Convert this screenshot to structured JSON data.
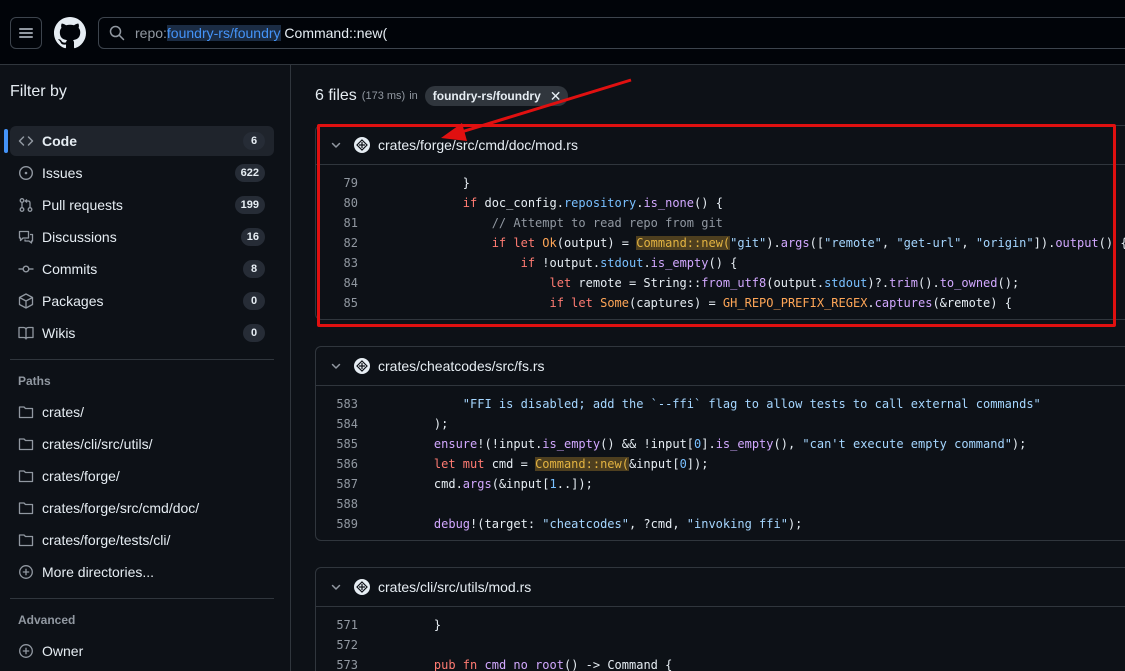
{
  "header": {
    "search_qualifier": "repo:",
    "search_repo": "foundry-rs/foundry",
    "search_text": " Command::new("
  },
  "sidebar": {
    "title": "Filter by",
    "nav": [
      {
        "label": "Code",
        "count": "6",
        "icon": "code-icon",
        "active": true
      },
      {
        "label": "Issues",
        "count": "622",
        "icon": "issue-icon"
      },
      {
        "label": "Pull requests",
        "count": "199",
        "icon": "pull-request-icon"
      },
      {
        "label": "Discussions",
        "count": "16",
        "icon": "discussion-icon"
      },
      {
        "label": "Commits",
        "count": "8",
        "icon": "commit-icon"
      },
      {
        "label": "Packages",
        "count": "0",
        "icon": "package-icon"
      },
      {
        "label": "Wikis",
        "count": "0",
        "icon": "book-icon"
      }
    ],
    "paths_title": "Paths",
    "paths": [
      "crates/",
      "crates/cli/src/utils/",
      "crates/forge/",
      "crates/forge/src/cmd/doc/",
      "crates/forge/tests/cli/"
    ],
    "more_dirs": "More directories...",
    "advanced_title": "Advanced",
    "owner": "Owner"
  },
  "results": {
    "count_text": "6 files",
    "ms": "(173 ms)",
    "in": "in",
    "repo_chip": "foundry-rs/foundry"
  },
  "cards": [
    {
      "path": "crates/forge/src/cmd/doc/mod.rs",
      "lines": [
        "79",
        "80",
        "81",
        "82",
        "83",
        "84",
        "85"
      ]
    },
    {
      "path": "crates/cheatcodes/src/fs.rs",
      "lines": [
        "583",
        "584",
        "585",
        "586",
        "587",
        "588",
        "589"
      ]
    },
    {
      "path": "crates/cli/src/utils/mod.rs",
      "lines": [
        "571",
        "572",
        "573"
      ]
    }
  ],
  "colors": {
    "accent": "#4493f8",
    "annotation": "#e01010",
    "match_highlight": "#4e3f1f"
  }
}
